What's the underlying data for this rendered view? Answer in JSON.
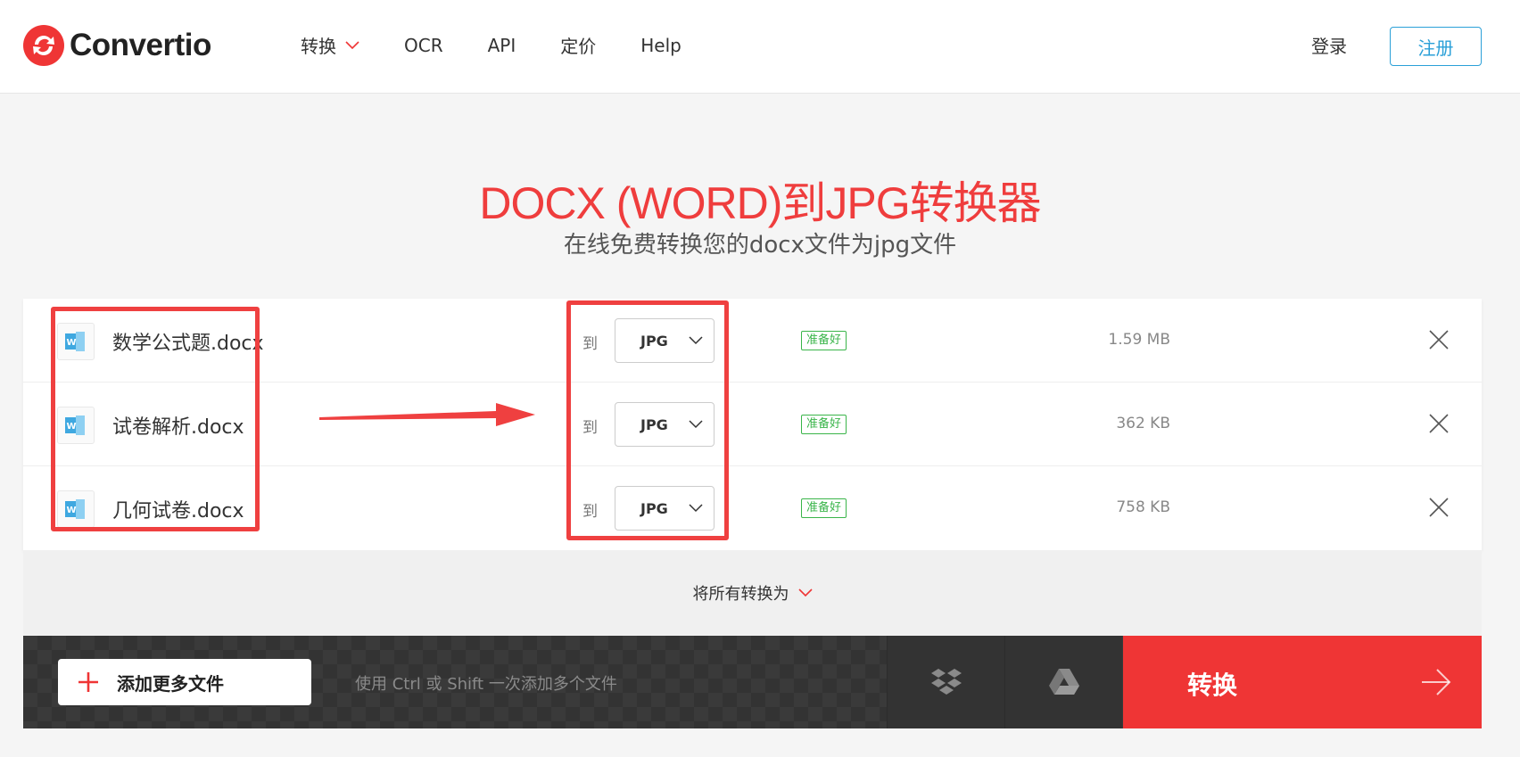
{
  "header": {
    "brand": "Convertio",
    "nav": [
      {
        "label": "转换",
        "has_dropdown": true
      },
      {
        "label": "OCR"
      },
      {
        "label": "API"
      },
      {
        "label": "定价"
      },
      {
        "label": "Help"
      }
    ],
    "login": "登录",
    "signup": "注册"
  },
  "hero": {
    "title": "DOCX (WORD)到JPG转换器",
    "subtitle": "在线免费转换您的docx文件为jpg文件"
  },
  "files": [
    {
      "name": "数学公式题.docx",
      "to": "到",
      "format": "JPG",
      "status": "准备好",
      "size": "1.59 MB"
    },
    {
      "name": "试卷解析.docx",
      "to": "到",
      "format": "JPG",
      "status": "准备好",
      "size": "362 KB"
    },
    {
      "name": "几何试卷.docx",
      "to": "到",
      "format": "JPG",
      "status": "准备好",
      "size": "758 KB"
    }
  ],
  "convert_all": {
    "label": "将所有转换为"
  },
  "bottom_bar": {
    "add_more": "添加更多文件",
    "hint": "使用 Ctrl 或 Shift 一次添加多个文件",
    "convert": "转换"
  },
  "icons": {
    "logo": "convertio-logo-icon",
    "file": "word-file-icon",
    "dropbox": "dropbox-icon",
    "drive": "google-drive-icon",
    "remove": "close-icon"
  },
  "colors": {
    "accent": "#ef3535",
    "signup": "#2ba0d8",
    "ready": "#3ab54a",
    "annotation": "#ef4040"
  }
}
